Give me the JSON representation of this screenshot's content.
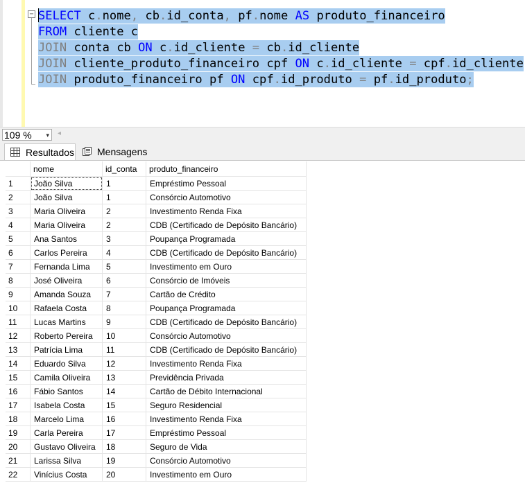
{
  "editor": {
    "lines": [
      [
        {
          "t": "SELECT",
          "c": "kw"
        },
        {
          "t": " c",
          "c": ""
        },
        {
          "t": ".",
          "c": "gr"
        },
        {
          "t": "nome",
          "c": ""
        },
        {
          "t": ",",
          "c": "gr"
        },
        {
          "t": " cb",
          "c": ""
        },
        {
          "t": ".",
          "c": "gr"
        },
        {
          "t": "id_conta",
          "c": ""
        },
        {
          "t": ",",
          "c": "gr"
        },
        {
          "t": " pf",
          "c": ""
        },
        {
          "t": ".",
          "c": "gr"
        },
        {
          "t": "nome ",
          "c": ""
        },
        {
          "t": "AS",
          "c": "kw"
        },
        {
          "t": " produto_financeiro",
          "c": ""
        }
      ],
      [
        {
          "t": "FROM",
          "c": "kw"
        },
        {
          "t": " cliente c",
          "c": ""
        }
      ],
      [
        {
          "t": "JOIN",
          "c": "gr"
        },
        {
          "t": " conta cb ",
          "c": ""
        },
        {
          "t": "ON",
          "c": "kw"
        },
        {
          "t": " c",
          "c": ""
        },
        {
          "t": ".",
          "c": "gr"
        },
        {
          "t": "id_cliente ",
          "c": ""
        },
        {
          "t": "=",
          "c": "gr"
        },
        {
          "t": " cb",
          "c": ""
        },
        {
          "t": ".",
          "c": "gr"
        },
        {
          "t": "id_cliente",
          "c": ""
        }
      ],
      [
        {
          "t": "JOIN",
          "c": "gr"
        },
        {
          "t": " cliente_produto_financeiro cpf ",
          "c": ""
        },
        {
          "t": "ON",
          "c": "kw"
        },
        {
          "t": " c",
          "c": ""
        },
        {
          "t": ".",
          "c": "gr"
        },
        {
          "t": "id_cliente ",
          "c": ""
        },
        {
          "t": "=",
          "c": "gr"
        },
        {
          "t": " cpf",
          "c": ""
        },
        {
          "t": ".",
          "c": "gr"
        },
        {
          "t": "id_cliente",
          "c": ""
        }
      ],
      [
        {
          "t": "JOIN",
          "c": "gr"
        },
        {
          "t": " produto_financeiro pf ",
          "c": ""
        },
        {
          "t": "ON",
          "c": "kw"
        },
        {
          "t": " cpf",
          "c": ""
        },
        {
          "t": ".",
          "c": "gr"
        },
        {
          "t": "id_produto ",
          "c": ""
        },
        {
          "t": "=",
          "c": "gr"
        },
        {
          "t": " pf",
          "c": ""
        },
        {
          "t": ".",
          "c": "gr"
        },
        {
          "t": "id_produto",
          "c": ""
        },
        {
          "t": ";",
          "c": "gr"
        }
      ]
    ],
    "collapse_glyph": "−"
  },
  "zoom": {
    "value": "109 %",
    "arrow": "▾",
    "scroll_left": "◂"
  },
  "tabs": {
    "results": "Resultados",
    "messages": "Mensagens"
  },
  "grid": {
    "columns": [
      "",
      "nome",
      "id_conta",
      "produto_financeiro"
    ],
    "rows": [
      [
        "1",
        "João Silva",
        "1",
        "Empréstimo Pessoal"
      ],
      [
        "2",
        "João Silva",
        "1",
        "Consórcio Automotivo"
      ],
      [
        "3",
        "Maria Oliveira",
        "2",
        "Investimento Renda Fixa"
      ],
      [
        "4",
        "Maria Oliveira",
        "2",
        "CDB (Certificado de Depósito Bancário)"
      ],
      [
        "5",
        "Ana Santos",
        "3",
        "Poupança Programada"
      ],
      [
        "6",
        "Carlos Pereira",
        "4",
        "CDB (Certificado de Depósito Bancário)"
      ],
      [
        "7",
        "Fernanda Lima",
        "5",
        "Investimento em Ouro"
      ],
      [
        "8",
        "José Oliveira",
        "6",
        "Consórcio de Imóveis"
      ],
      [
        "9",
        "Amanda Souza",
        "7",
        "Cartão de Crédito"
      ],
      [
        "10",
        "Rafaela Costa",
        "8",
        "Poupança Programada"
      ],
      [
        "11",
        "Lucas Martins",
        "9",
        "CDB (Certificado de Depósito Bancário)"
      ],
      [
        "12",
        "Roberto Pereira",
        "10",
        "Consórcio Automotivo"
      ],
      [
        "13",
        "Patrícia Lima",
        "11",
        "CDB (Certificado de Depósito Bancário)"
      ],
      [
        "14",
        "Eduardo Silva",
        "12",
        "Investimento Renda Fixa"
      ],
      [
        "15",
        "Camila Oliveira",
        "13",
        "Previdência Privada"
      ],
      [
        "16",
        "Fábio Santos",
        "14",
        "Cartão de Débito Internacional"
      ],
      [
        "17",
        "Isabela Costa",
        "15",
        "Seguro Residencial"
      ],
      [
        "18",
        "Marcelo Lima",
        "16",
        "Investimento Renda Fixa"
      ],
      [
        "19",
        "Carla Pereira",
        "17",
        "Empréstimo Pessoal"
      ],
      [
        "20",
        "Gustavo Oliveira",
        "18",
        "Seguro de Vida"
      ],
      [
        "21",
        "Larissa Silva",
        "19",
        "Consórcio Automotivo"
      ],
      [
        "22",
        "Vinícius Costa",
        "20",
        "Investimento em Ouro"
      ]
    ]
  }
}
